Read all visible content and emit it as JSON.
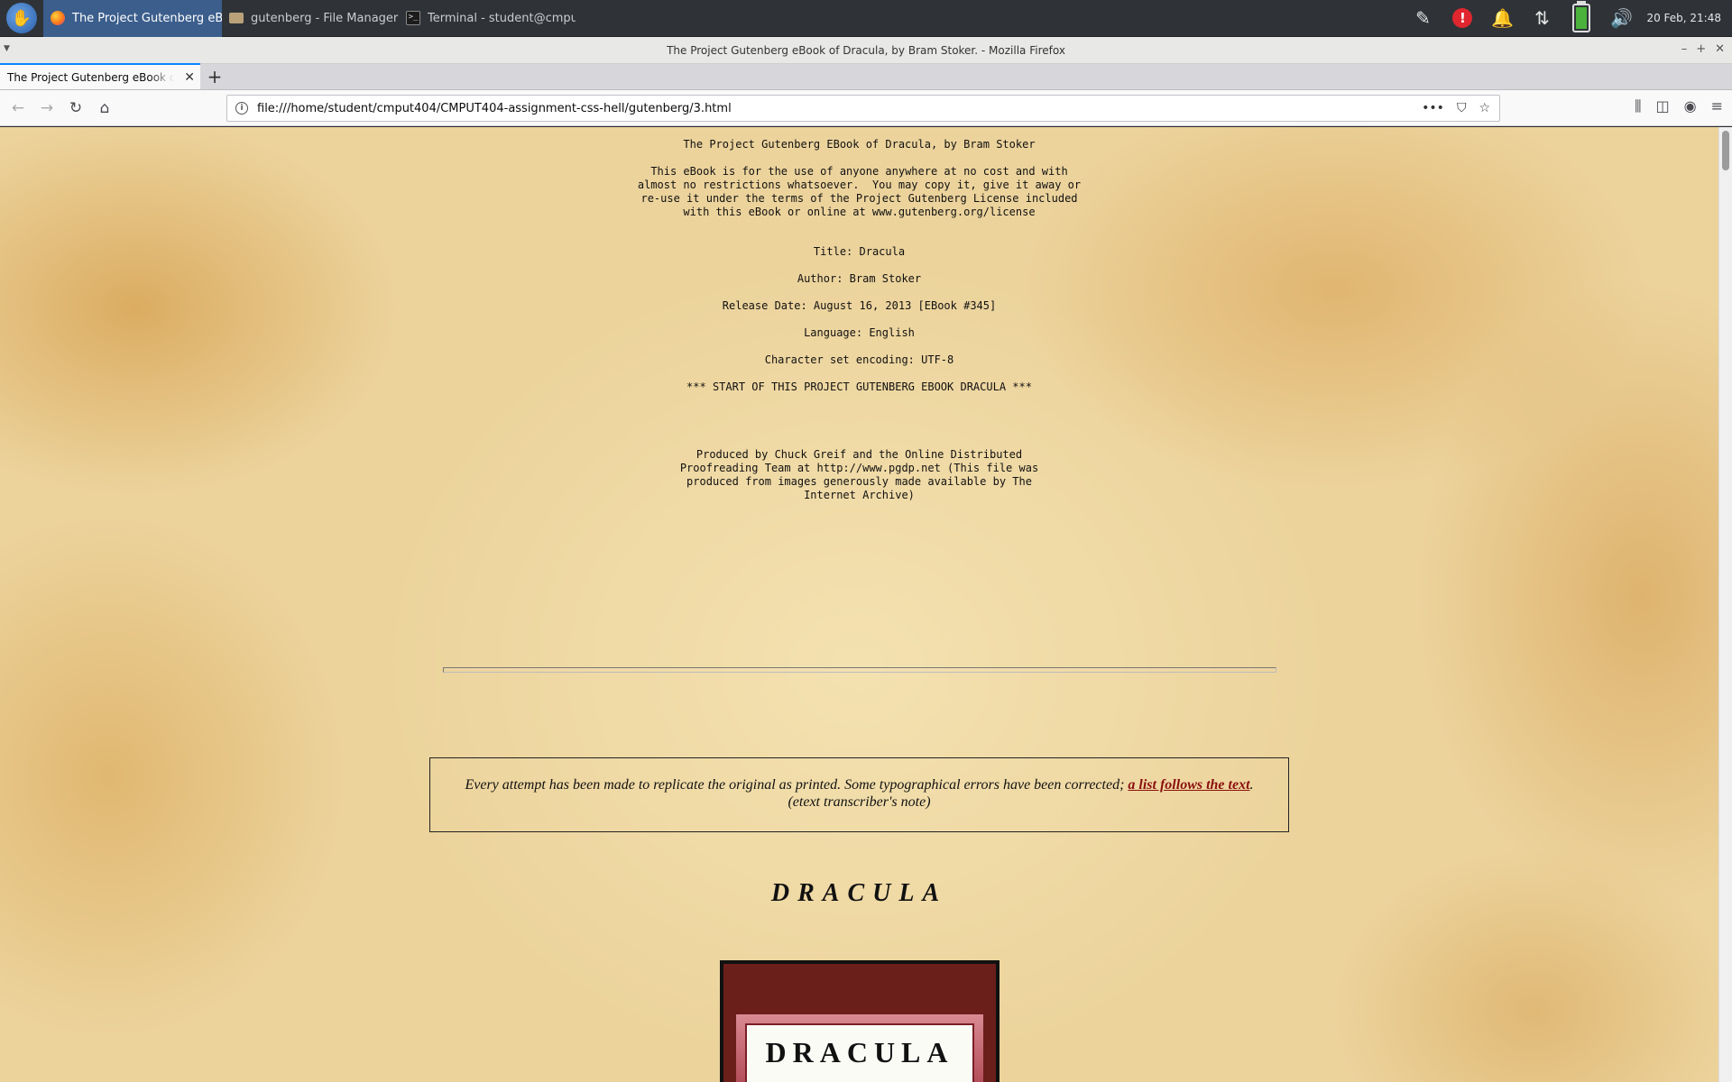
{
  "taskbar": {
    "tasks": [
      {
        "label": "The Project Gutenberg eBoo..."
      },
      {
        "label": "gutenberg - File Manager"
      },
      {
        "label": "Terminal - student@cmput40..."
      }
    ],
    "clock": "20 Feb, 21:48"
  },
  "window": {
    "title": "The Project Gutenberg eBook of Dracula, by Bram Stoker. - Mozilla Firefox"
  },
  "browser": {
    "tab_label": "The Project Gutenberg eBook of Dracula, by Bram Stoker.",
    "url": "file:///home/student/cmput404/CMPUT404-assignment-css-hell/gutenberg/3.html"
  },
  "page": {
    "header_title": "The Project Gutenberg EBook of Dracula, by Bram Stoker",
    "header_body": "This eBook is for the use of anyone anywhere at no cost and with\nalmost no restrictions whatsoever.  You may copy it, give it away or\nre-use it under the terms of the Project Gutenberg License included\nwith this eBook or online at www.gutenberg.org/license",
    "meta_title": "Title: Dracula",
    "meta_author": "Author: Bram Stoker",
    "meta_release": "Release Date: August 16, 2013 [EBook #345]",
    "meta_language": "Language: English",
    "meta_encoding": "Character set encoding: UTF-8",
    "start_marker": "*** START OF THIS PROJECT GUTENBERG EBOOK DRACULA ***",
    "produced_by": "Produced by Chuck Greif and the Online Distributed\nProofreading Team at http://www.pgdp.net (This file was\nproduced from images generously made available by The\nInternet Archive)",
    "note_text": "Every attempt has been made to replicate the original as printed. Some typographical errors have been corrected;",
    "note_link": "a list follows the text",
    "note_period": ".",
    "note_sub": "(etext transcriber's note)",
    "book_heading": "DRACULA",
    "cover_title": "DRACULA"
  }
}
